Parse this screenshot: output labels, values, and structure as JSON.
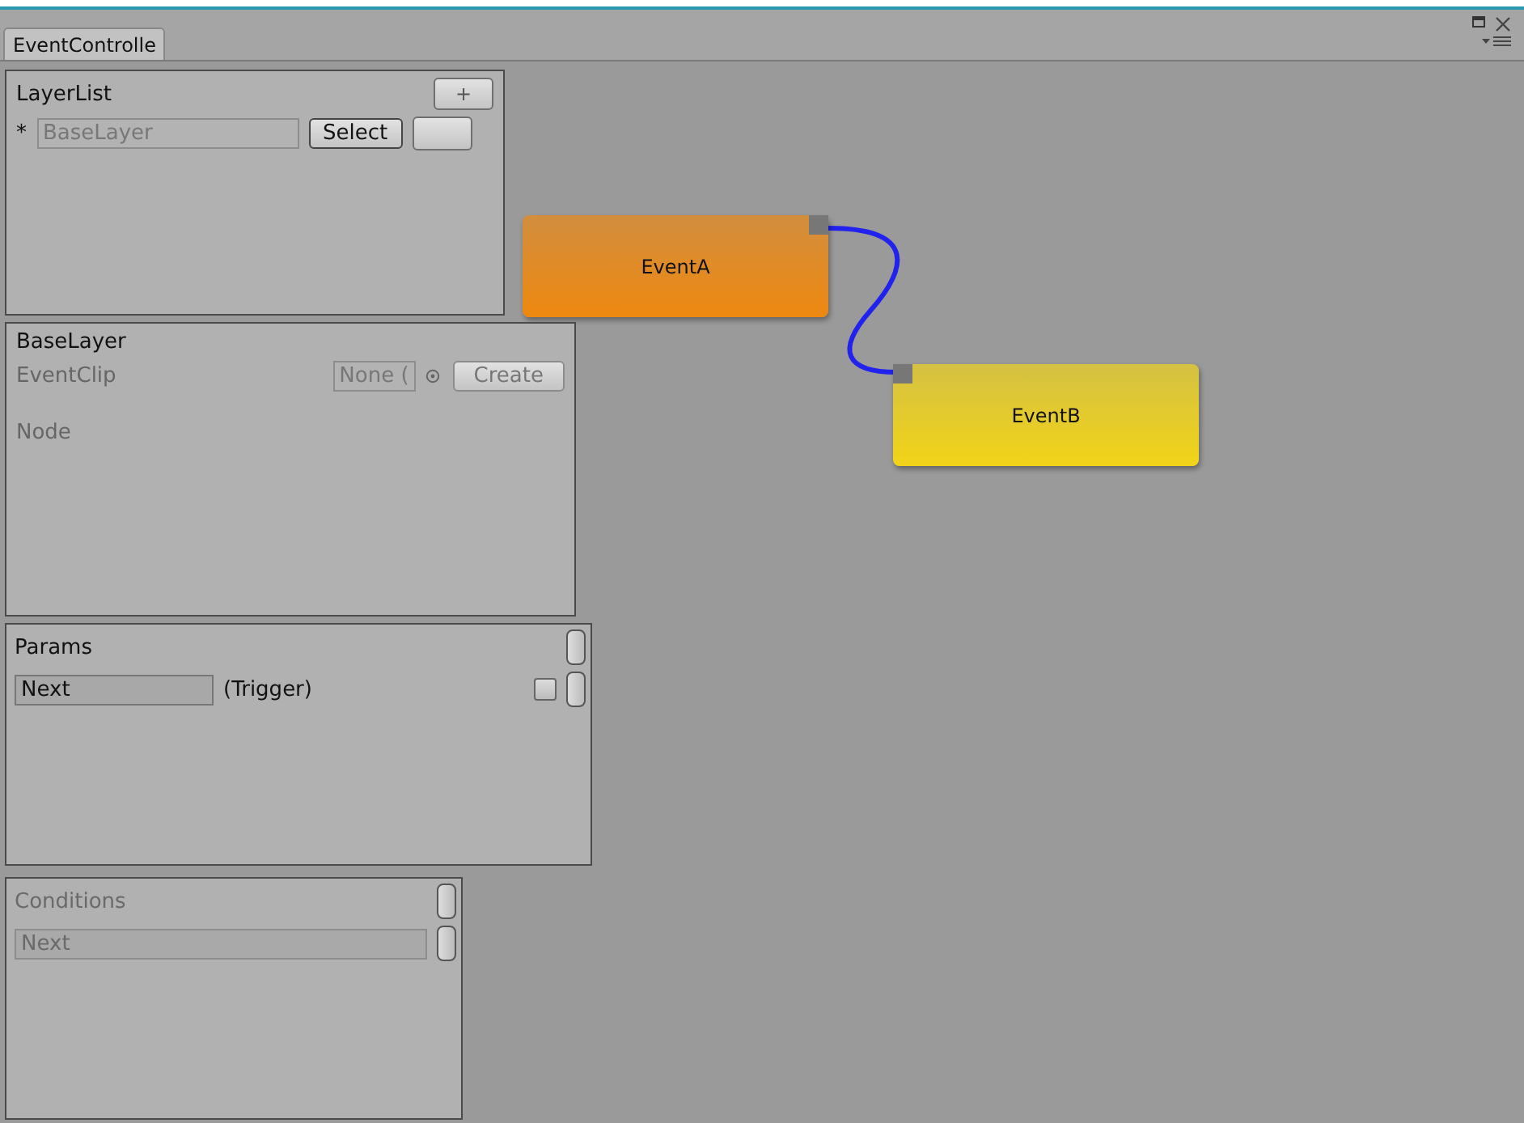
{
  "tab": {
    "title": "EventControlle",
    "selected": true
  },
  "layer_list": {
    "title": "LayerList",
    "add_button": "+",
    "items": [
      {
        "marker": "*",
        "name": "BaseLayer",
        "disabled": true,
        "button": "Select"
      }
    ]
  },
  "base_layer": {
    "title": "BaseLayer",
    "fields": [
      {
        "label": "EventClip",
        "value": "None (",
        "button": "Create",
        "disabled": true
      }
    ],
    "node_label": "Node"
  },
  "params": {
    "title": "Params",
    "items": [
      {
        "name": "Next",
        "type": "(Trigger)",
        "checked": false
      }
    ]
  },
  "conditions": {
    "title": "Conditions",
    "disabled": true,
    "items": [
      {
        "name": "Next"
      }
    ]
  },
  "graph": {
    "nodes": [
      {
        "label": "EventA",
        "color": "#ee8810"
      },
      {
        "label": "EventB",
        "color": "#f2d418"
      }
    ]
  }
}
